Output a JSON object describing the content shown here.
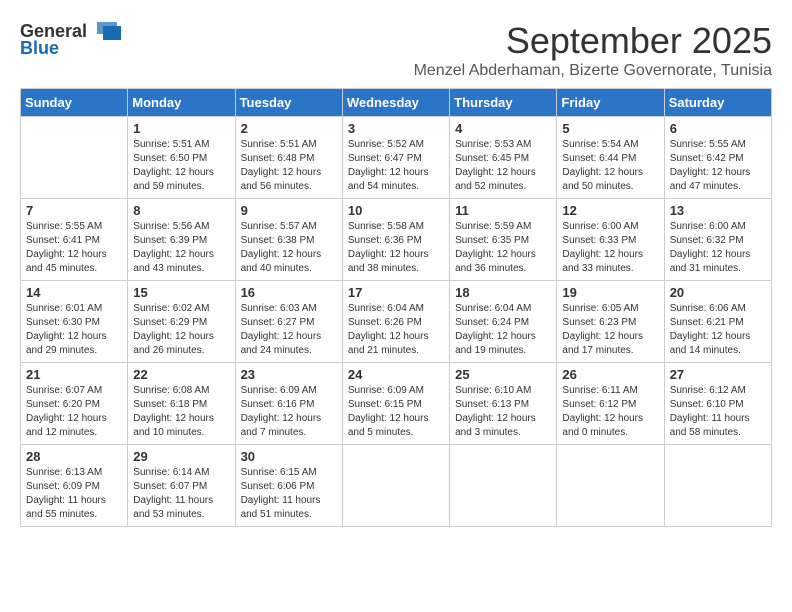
{
  "logo": {
    "general": "General",
    "blue": "Blue"
  },
  "title": "September 2025",
  "location": "Menzel Abderhaman, Bizerte Governorate, Tunisia",
  "weekdays": [
    "Sunday",
    "Monday",
    "Tuesday",
    "Wednesday",
    "Thursday",
    "Friday",
    "Saturday"
  ],
  "weeks": [
    [
      {
        "day": "",
        "info": ""
      },
      {
        "day": "1",
        "info": "Sunrise: 5:51 AM\nSunset: 6:50 PM\nDaylight: 12 hours\nand 59 minutes."
      },
      {
        "day": "2",
        "info": "Sunrise: 5:51 AM\nSunset: 6:48 PM\nDaylight: 12 hours\nand 56 minutes."
      },
      {
        "day": "3",
        "info": "Sunrise: 5:52 AM\nSunset: 6:47 PM\nDaylight: 12 hours\nand 54 minutes."
      },
      {
        "day": "4",
        "info": "Sunrise: 5:53 AM\nSunset: 6:45 PM\nDaylight: 12 hours\nand 52 minutes."
      },
      {
        "day": "5",
        "info": "Sunrise: 5:54 AM\nSunset: 6:44 PM\nDaylight: 12 hours\nand 50 minutes."
      },
      {
        "day": "6",
        "info": "Sunrise: 5:55 AM\nSunset: 6:42 PM\nDaylight: 12 hours\nand 47 minutes."
      }
    ],
    [
      {
        "day": "7",
        "info": "Sunrise: 5:55 AM\nSunset: 6:41 PM\nDaylight: 12 hours\nand 45 minutes."
      },
      {
        "day": "8",
        "info": "Sunrise: 5:56 AM\nSunset: 6:39 PM\nDaylight: 12 hours\nand 43 minutes."
      },
      {
        "day": "9",
        "info": "Sunrise: 5:57 AM\nSunset: 6:38 PM\nDaylight: 12 hours\nand 40 minutes."
      },
      {
        "day": "10",
        "info": "Sunrise: 5:58 AM\nSunset: 6:36 PM\nDaylight: 12 hours\nand 38 minutes."
      },
      {
        "day": "11",
        "info": "Sunrise: 5:59 AM\nSunset: 6:35 PM\nDaylight: 12 hours\nand 36 minutes."
      },
      {
        "day": "12",
        "info": "Sunrise: 6:00 AM\nSunset: 6:33 PM\nDaylight: 12 hours\nand 33 minutes."
      },
      {
        "day": "13",
        "info": "Sunrise: 6:00 AM\nSunset: 6:32 PM\nDaylight: 12 hours\nand 31 minutes."
      }
    ],
    [
      {
        "day": "14",
        "info": "Sunrise: 6:01 AM\nSunset: 6:30 PM\nDaylight: 12 hours\nand 29 minutes."
      },
      {
        "day": "15",
        "info": "Sunrise: 6:02 AM\nSunset: 6:29 PM\nDaylight: 12 hours\nand 26 minutes."
      },
      {
        "day": "16",
        "info": "Sunrise: 6:03 AM\nSunset: 6:27 PM\nDaylight: 12 hours\nand 24 minutes."
      },
      {
        "day": "17",
        "info": "Sunrise: 6:04 AM\nSunset: 6:26 PM\nDaylight: 12 hours\nand 21 minutes."
      },
      {
        "day": "18",
        "info": "Sunrise: 6:04 AM\nSunset: 6:24 PM\nDaylight: 12 hours\nand 19 minutes."
      },
      {
        "day": "19",
        "info": "Sunrise: 6:05 AM\nSunset: 6:23 PM\nDaylight: 12 hours\nand 17 minutes."
      },
      {
        "day": "20",
        "info": "Sunrise: 6:06 AM\nSunset: 6:21 PM\nDaylight: 12 hours\nand 14 minutes."
      }
    ],
    [
      {
        "day": "21",
        "info": "Sunrise: 6:07 AM\nSunset: 6:20 PM\nDaylight: 12 hours\nand 12 minutes."
      },
      {
        "day": "22",
        "info": "Sunrise: 6:08 AM\nSunset: 6:18 PM\nDaylight: 12 hours\nand 10 minutes."
      },
      {
        "day": "23",
        "info": "Sunrise: 6:09 AM\nSunset: 6:16 PM\nDaylight: 12 hours\nand 7 minutes."
      },
      {
        "day": "24",
        "info": "Sunrise: 6:09 AM\nSunset: 6:15 PM\nDaylight: 12 hours\nand 5 minutes."
      },
      {
        "day": "25",
        "info": "Sunrise: 6:10 AM\nSunset: 6:13 PM\nDaylight: 12 hours\nand 3 minutes."
      },
      {
        "day": "26",
        "info": "Sunrise: 6:11 AM\nSunset: 6:12 PM\nDaylight: 12 hours\nand 0 minutes."
      },
      {
        "day": "27",
        "info": "Sunrise: 6:12 AM\nSunset: 6:10 PM\nDaylight: 11 hours\nand 58 minutes."
      }
    ],
    [
      {
        "day": "28",
        "info": "Sunrise: 6:13 AM\nSunset: 6:09 PM\nDaylight: 11 hours\nand 55 minutes."
      },
      {
        "day": "29",
        "info": "Sunrise: 6:14 AM\nSunset: 6:07 PM\nDaylight: 11 hours\nand 53 minutes."
      },
      {
        "day": "30",
        "info": "Sunrise: 6:15 AM\nSunset: 6:06 PM\nDaylight: 11 hours\nand 51 minutes."
      },
      {
        "day": "",
        "info": ""
      },
      {
        "day": "",
        "info": ""
      },
      {
        "day": "",
        "info": ""
      },
      {
        "day": "",
        "info": ""
      }
    ]
  ]
}
